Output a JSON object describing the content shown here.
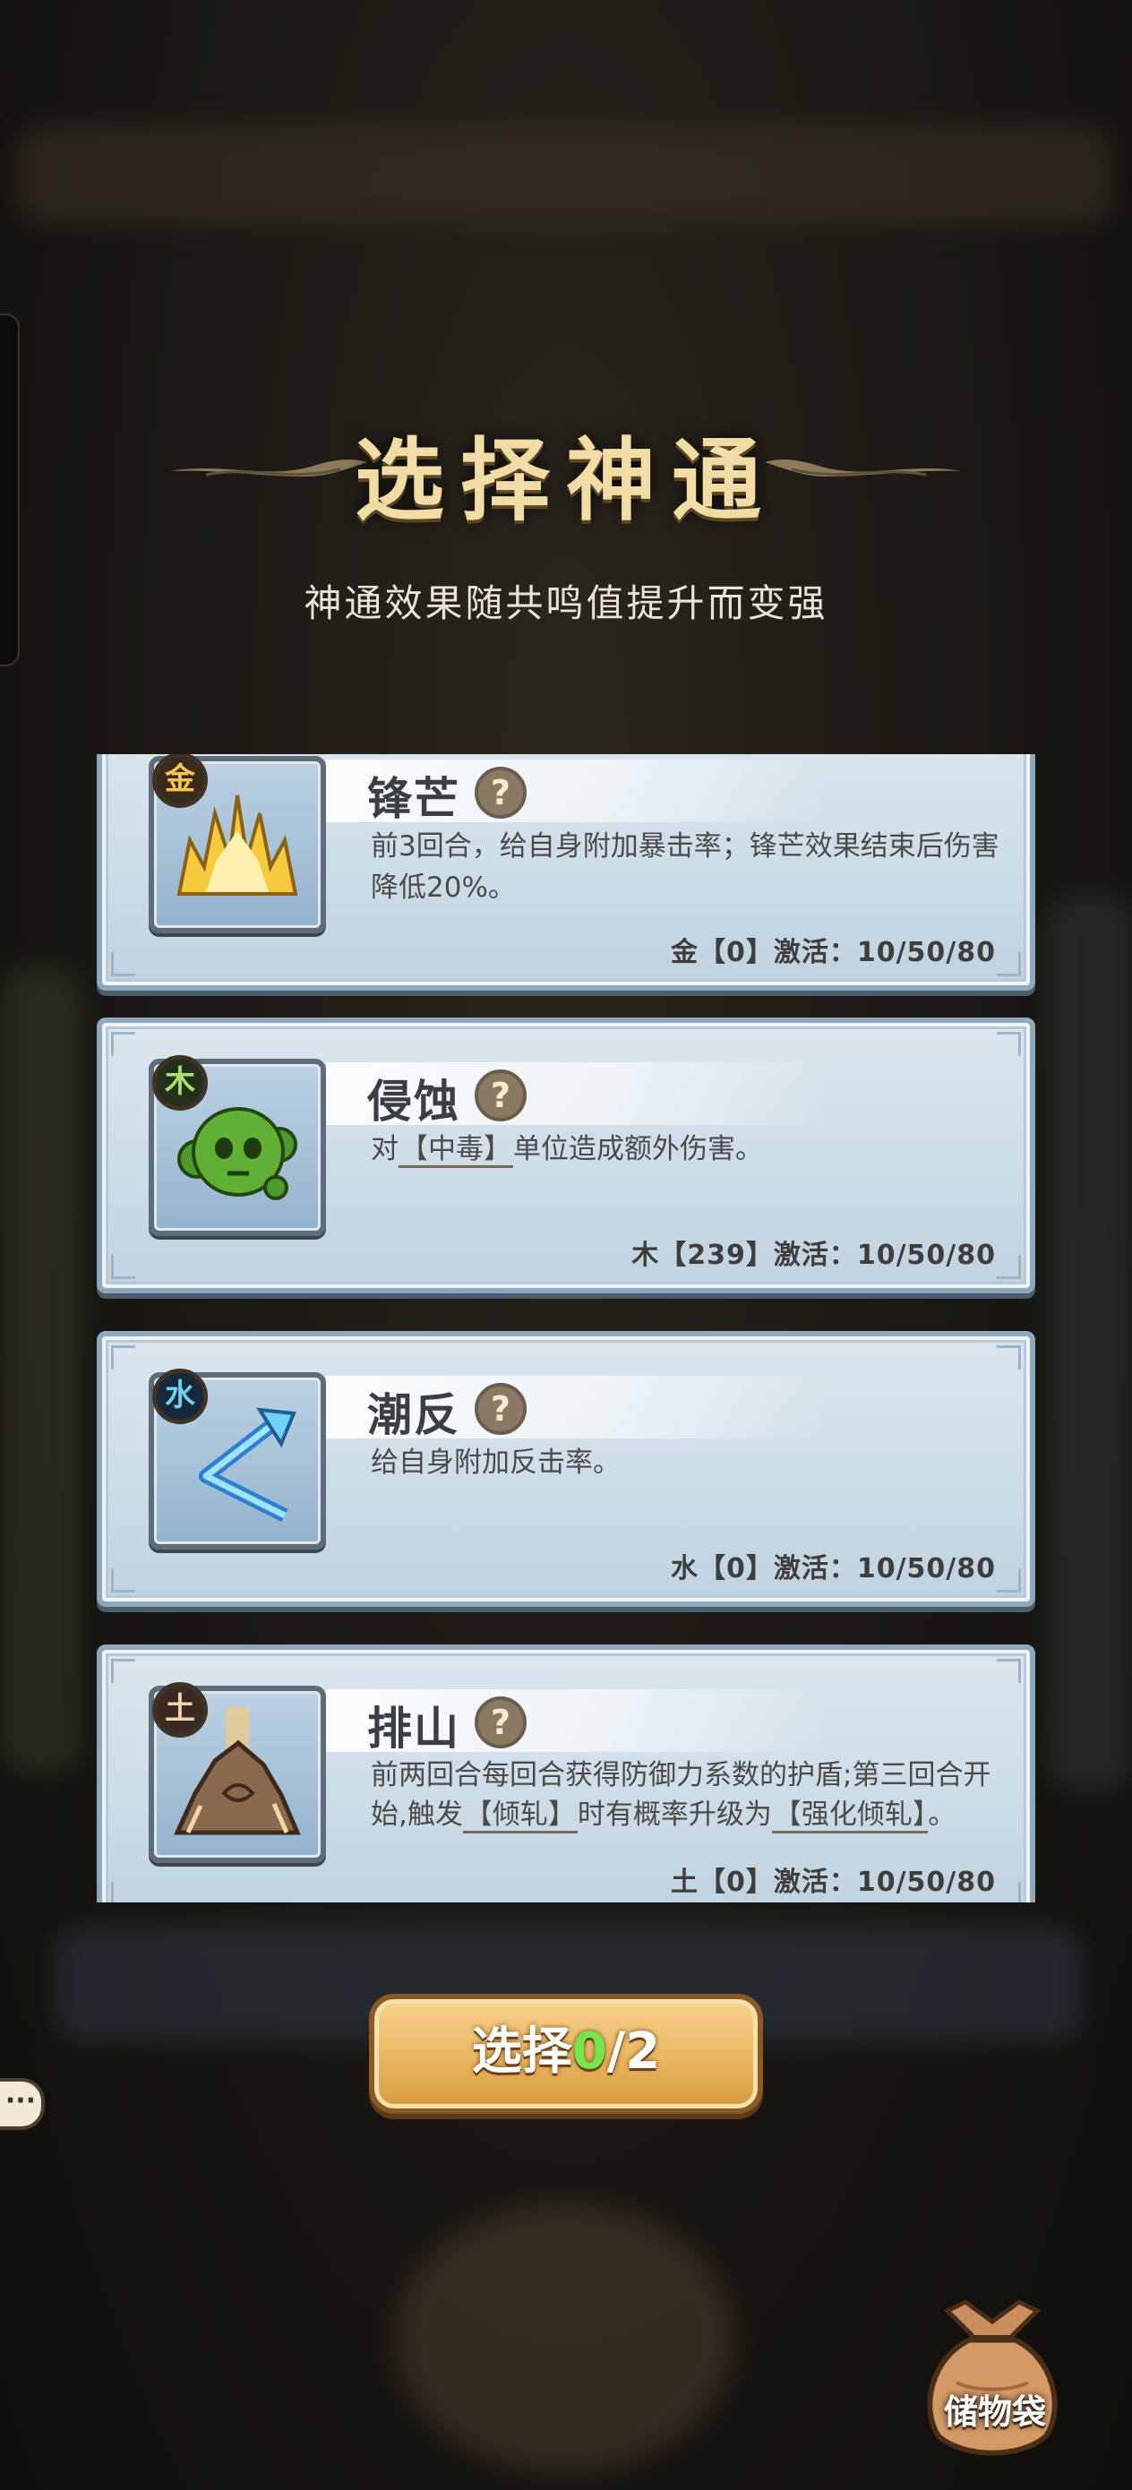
{
  "header": {
    "title": "选择神通",
    "subtitle": "神通效果随共鸣值提升而变强"
  },
  "skills": [
    {
      "element": "金",
      "name": "锋芒",
      "description": "前3回合，给自身附加暴击率；锋芒效果结束后伤害降低20%。",
      "footer": "金【0】激活：10/50/80",
      "icon": "golden-spikes-icon"
    },
    {
      "element": "木",
      "name": "侵蚀",
      "description_pre": "对",
      "description_keyword": "【中毒】",
      "description_post": "单位造成额外伤害。",
      "footer": "木【239】激活：10/50/80",
      "icon": "poison-blob-icon"
    },
    {
      "element": "水",
      "name": "潮反",
      "description": "给自身附加反击率。",
      "footer": "水【0】激活：10/50/80",
      "icon": "water-arrow-icon"
    },
    {
      "element": "土",
      "name": "排山",
      "description_a": "前两回合每回合获得防御力系数的护盾;第三回合开始,触发",
      "description_kw1": "【倾轧】",
      "description_b": "时有概率升级为",
      "description_kw2": "【强化倾轧】",
      "description_c": "。",
      "footer": "土【0】激活：10/50/80",
      "icon": "rock-spire-icon"
    }
  ],
  "select_button": {
    "prefix": "选择",
    "selected": "0",
    "total": "/2"
  },
  "bottom": {
    "more": "···",
    "bag_label": "储物袋"
  },
  "colors": {
    "title": "#f0dca4",
    "card_bg": "#cddde8",
    "button": "#ebb964",
    "selected_count": "#72e84a"
  }
}
